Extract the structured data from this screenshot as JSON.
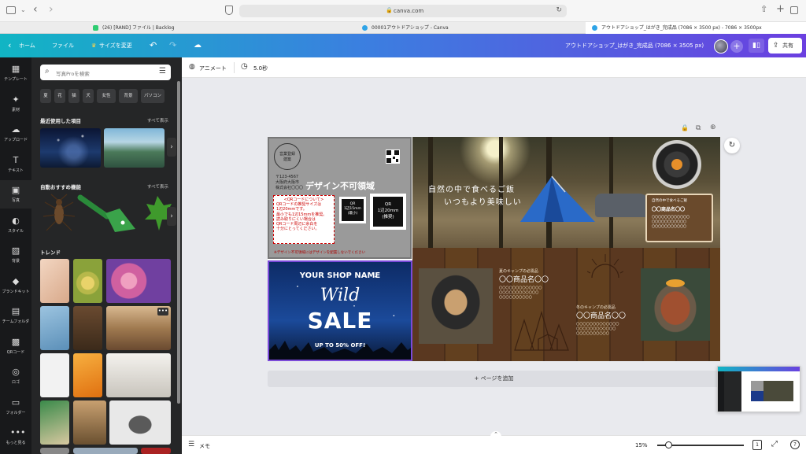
{
  "browser": {
    "url": "canva.com",
    "tabs": [
      {
        "label": "(26) [RAND] ファイル | Backlog",
        "color": "#2ecc71"
      },
      {
        "label": "00001アウトドアショップ - Canva",
        "color": "#2fa4e7"
      },
      {
        "label": "アウトドアショップ_はがき_完成品 (7086 × 3500 px) - 7086 × 3500px",
        "color": "#2fa4e7"
      }
    ]
  },
  "header": {
    "home": "ホーム",
    "file": "ファイル",
    "resize": "サイズを変更",
    "doc_title": "アウトドアショップ_はがき_完成品 (7086 × 3505 px)",
    "share": "共有"
  },
  "rail": [
    {
      "label": "テンプレート",
      "icon": "template-icon"
    },
    {
      "label": "素材",
      "icon": "elements-icon"
    },
    {
      "label": "アップロード",
      "icon": "upload-icon"
    },
    {
      "label": "テキスト",
      "icon": "text-icon"
    },
    {
      "label": "写真",
      "icon": "photo-icon"
    },
    {
      "label": "スタイル",
      "icon": "style-icon"
    },
    {
      "label": "背景",
      "icon": "background-icon"
    },
    {
      "label": "ブランドキット",
      "icon": "brand-icon"
    },
    {
      "label": "チームフォルダ",
      "icon": "team-folder-icon"
    },
    {
      "label": "QRコード",
      "icon": "qr-icon"
    },
    {
      "label": "ロゴ",
      "icon": "logo-icon"
    },
    {
      "label": "フォルダー",
      "icon": "folder-icon"
    },
    {
      "label": "もっと見る",
      "icon": "more-icon"
    }
  ],
  "panel": {
    "search_placeholder": "写真Proを検索",
    "chips": [
      "夏",
      "花",
      "猫",
      "犬",
      "女性",
      "背景",
      "パソコン"
    ],
    "recent_title": "最近使用した項目",
    "auto_title": "自動おすすめ機能",
    "trend_title": "トレンド",
    "see_all": "すべて表示"
  },
  "toolbar": {
    "animate": "アニメート",
    "duration": "5.0秒"
  },
  "design": {
    "no_design_area": "デザイン不可領域",
    "shop_stamp": [
      "営業登録",
      "建築"
    ],
    "address_lines": [
      "〒123-4567",
      "大阪府大阪市",
      "株式会社〇〇〇"
    ],
    "qr_note_title": "<QRコードについて>",
    "qr_note_body": [
      "QRコードの推奨サイズは",
      "1辺20mmです。",
      "最小でも1辺15mmを推奨。",
      "読み取りにくい場合は",
      "QRコード周辺に余白を",
      "十分にとってください。"
    ],
    "qr_small": [
      "QR",
      "1辺15mm",
      "(最小)"
    ],
    "qr_large": [
      "QR",
      "1辺20mm",
      "(推奨)"
    ],
    "footer_note": "※デザイン不可領域にはデザインを配置しないでください",
    "shop_name": "YOUR SHOP NAME",
    "sale_script": "Wild",
    "sale_word": "SALE",
    "sale_sub": "UP TO 50% OFF!",
    "hero_copy": [
      "自然の中で食べるご飯",
      "いつもより美味しい"
    ],
    "tag_title": "自然の中で食べるご飯",
    "tag_product": "〇〇商品名〇〇",
    "tag_desc": [
      "〇〇〇〇〇〇〇〇〇〇〇〇",
      "〇〇〇〇〇〇〇〇〇〇〇",
      "〇〇〇〇〇〇〇〇〇〇〇"
    ],
    "item1_cat": "夏のキャンプの必需品",
    "item1_name": "〇〇商品名〇〇",
    "item1_desc": [
      "〇〇〇〇〇〇〇〇〇〇〇〇〇",
      "〇〇〇〇〇〇〇〇〇〇〇〇",
      "〇〇〇〇〇〇〇〇〇〇"
    ],
    "item2_cat": "冬のキャンプの必需品",
    "item2_name": "〇〇商品名〇〇",
    "item2_desc": [
      "〇〇〇〇〇〇〇〇〇〇〇〇〇",
      "〇〇〇〇〇〇〇〇〇〇〇〇",
      "〇〇〇〇〇〇〇〇〇〇"
    ]
  },
  "add_page": "+ ページを追加",
  "bottom": {
    "notes": "メモ",
    "zoom": "15%",
    "page_count": "1"
  }
}
